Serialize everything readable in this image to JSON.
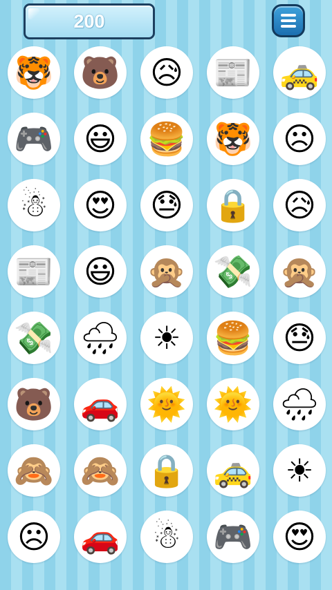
{
  "score": "200",
  "menu": {
    "icon": "hamburger-menu-icon"
  },
  "grid": {
    "rows": [
      [
        {
          "icon": "tiger-face-icon",
          "glyph": "🐯"
        },
        {
          "icon": "bear-face-icon",
          "glyph": "🐻"
        },
        {
          "icon": "sad-relieved-face-icon",
          "glyph": "😥"
        },
        {
          "icon": "newspaper-icon",
          "glyph": "📰"
        },
        {
          "icon": "taxi-icon",
          "glyph": "🚕"
        }
      ],
      [
        {
          "icon": "game-controller-icon",
          "glyph": "🎮"
        },
        {
          "icon": "grinning-face-icon",
          "glyph": "😃"
        },
        {
          "icon": "hamburger-icon",
          "glyph": "🍔"
        },
        {
          "icon": "tiger-face-icon",
          "glyph": "🐯"
        },
        {
          "icon": "frowning-face-icon",
          "glyph": "☹"
        }
      ],
      [
        {
          "icon": "snowman-icon",
          "glyph": "☃"
        },
        {
          "icon": "heart-eyes-face-icon",
          "glyph": "😍"
        },
        {
          "icon": "downcast-sweat-face-icon",
          "glyph": "😓"
        },
        {
          "icon": "padlock-icon",
          "glyph": "🔒"
        },
        {
          "icon": "sad-relieved-face-icon",
          "glyph": "😥"
        }
      ],
      [
        {
          "icon": "newspaper-icon",
          "glyph": "📰"
        },
        {
          "icon": "grinning-face-icon",
          "glyph": "😃"
        },
        {
          "icon": "speak-no-evil-monkey-icon",
          "glyph": "🙊"
        },
        {
          "icon": "money-with-wings-icon",
          "glyph": "💸"
        },
        {
          "icon": "speak-no-evil-monkey-icon",
          "glyph": "🙊"
        }
      ],
      [
        {
          "icon": "money-with-wings-icon",
          "glyph": "💸"
        },
        {
          "icon": "rain-cloud-icon",
          "glyph": "🌧"
        },
        {
          "icon": "sun-icon",
          "glyph": "☀"
        },
        {
          "icon": "hamburger-icon",
          "glyph": "🍔"
        },
        {
          "icon": "downcast-sweat-face-icon",
          "glyph": "😓"
        }
      ],
      [
        {
          "icon": "bear-face-icon",
          "glyph": "🐻"
        },
        {
          "icon": "red-car-icon",
          "glyph": "🚗"
        },
        {
          "icon": "sun-with-face-icon",
          "glyph": "🌞"
        },
        {
          "icon": "sun-with-face-icon",
          "glyph": "🌞"
        },
        {
          "icon": "rain-cloud-icon",
          "glyph": "🌧"
        }
      ],
      [
        {
          "icon": "see-no-evil-monkey-icon",
          "glyph": "🙈"
        },
        {
          "icon": "see-no-evil-monkey-icon",
          "glyph": "🙈"
        },
        {
          "icon": "padlock-icon",
          "glyph": "🔒"
        },
        {
          "icon": "taxi-icon",
          "glyph": "🚕"
        },
        {
          "icon": "sun-icon",
          "glyph": "☀"
        }
      ],
      [
        {
          "icon": "frowning-face-icon",
          "glyph": "☹"
        },
        {
          "icon": "red-car-icon",
          "glyph": "🚗"
        },
        {
          "icon": "snowman-icon",
          "glyph": "☃"
        },
        {
          "icon": "game-controller-icon",
          "glyph": "🎮"
        },
        {
          "icon": "heart-eyes-face-icon",
          "glyph": "😍"
        }
      ]
    ]
  }
}
